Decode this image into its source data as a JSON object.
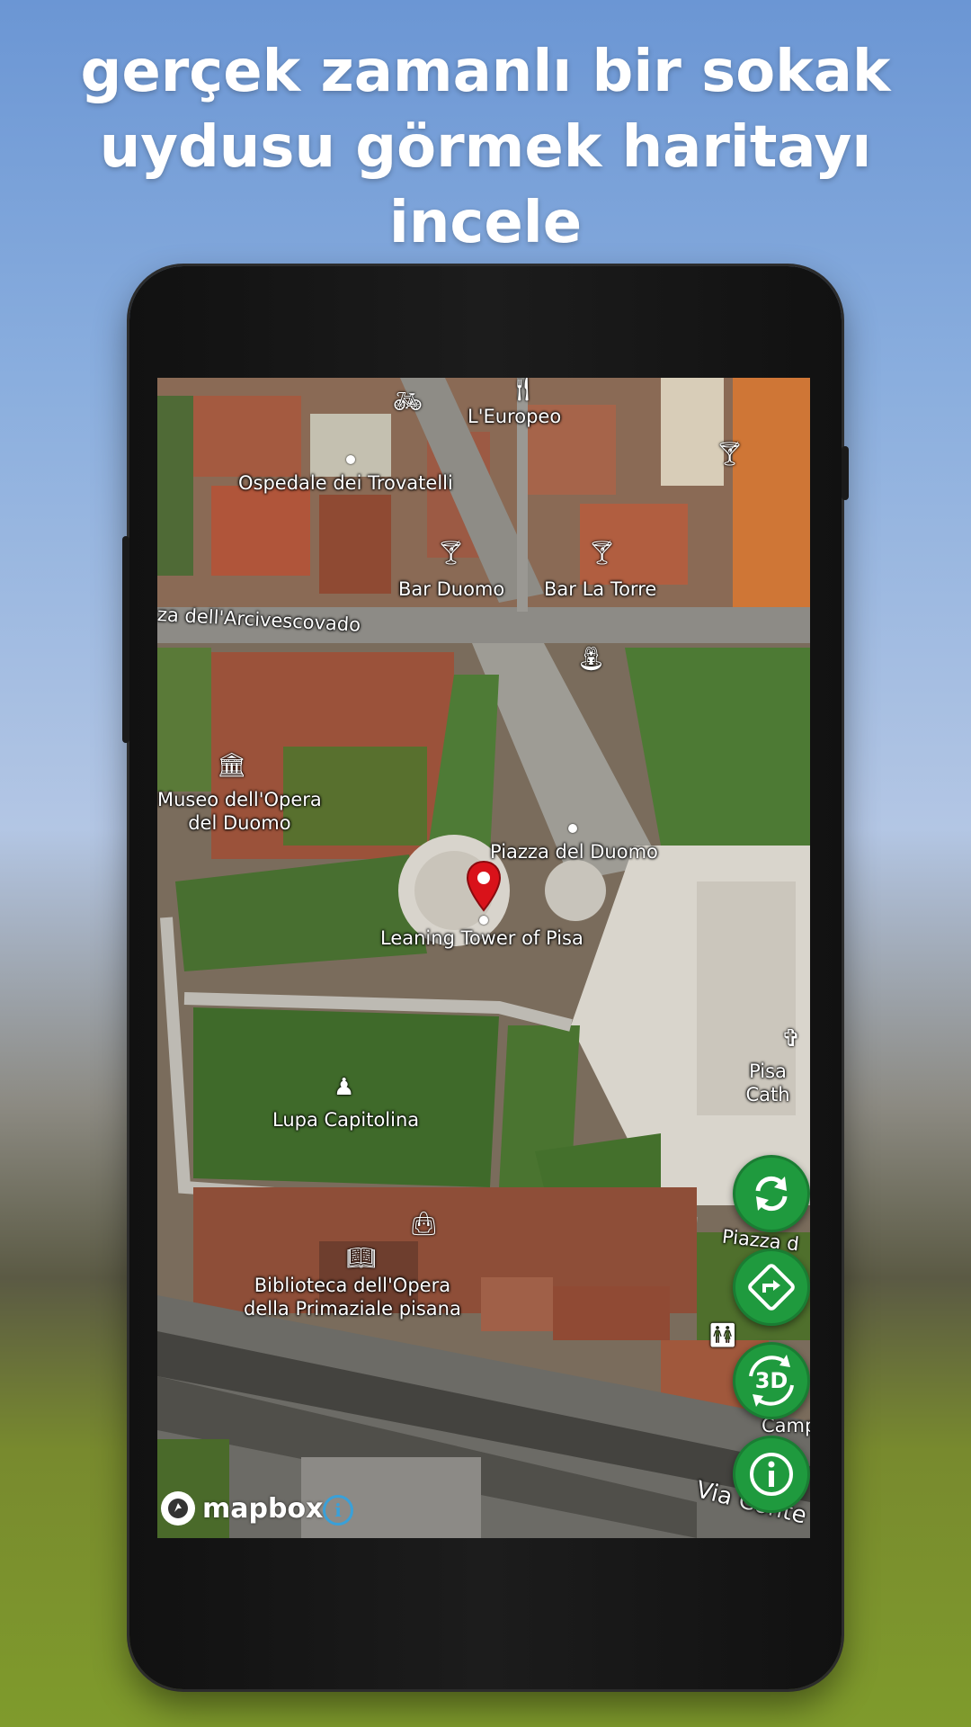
{
  "headline": "gerçek zamanlı bir sokak\nuydusu görmek haritayı\nincele",
  "map": {
    "labels": {
      "leuropeo": "L'Europeo",
      "ospedale": "Ospedale dei Trovatelli",
      "bar_duomo": "Bar Duomo",
      "bar_la_torre": "Bar La Torre",
      "arcivescovado": "za dell'Arcivescovado",
      "museo": "Museo dell'Opera\ndel Duomo",
      "piazza_duomo": "Piazza del Duomo",
      "leaning_tower": "Leaning Tower of Pisa",
      "pisa_cath": "Pisa Cath",
      "lupa": "Lupa Capitolina",
      "piazza_d": "Piazza d",
      "biblioteca": "Biblioteca dell'Opera\ndella Primaziale pisana",
      "camp": "Camp",
      "via_conte": "Via Conte"
    },
    "icons": {
      "bicycle": "bicycle-icon",
      "restaurant": "restaurant-icon",
      "bar": "cocktail-icon",
      "museum": "museum-icon",
      "monument": "monument-icon",
      "shop": "shopping-bag-icon",
      "library": "book-icon",
      "church": "church-cross-icon",
      "toilets": "toilets-icon",
      "drinking_water": "drinking-water-icon"
    },
    "marker_color": "#d9121a"
  },
  "controls": {
    "refresh": "refresh-icon",
    "directions": "directions-icon",
    "view_3d": "3D",
    "info": "info-icon",
    "accent": "#1f9a3e"
  },
  "attribution": {
    "brand": "mapbox",
    "info_symbol": "i"
  }
}
